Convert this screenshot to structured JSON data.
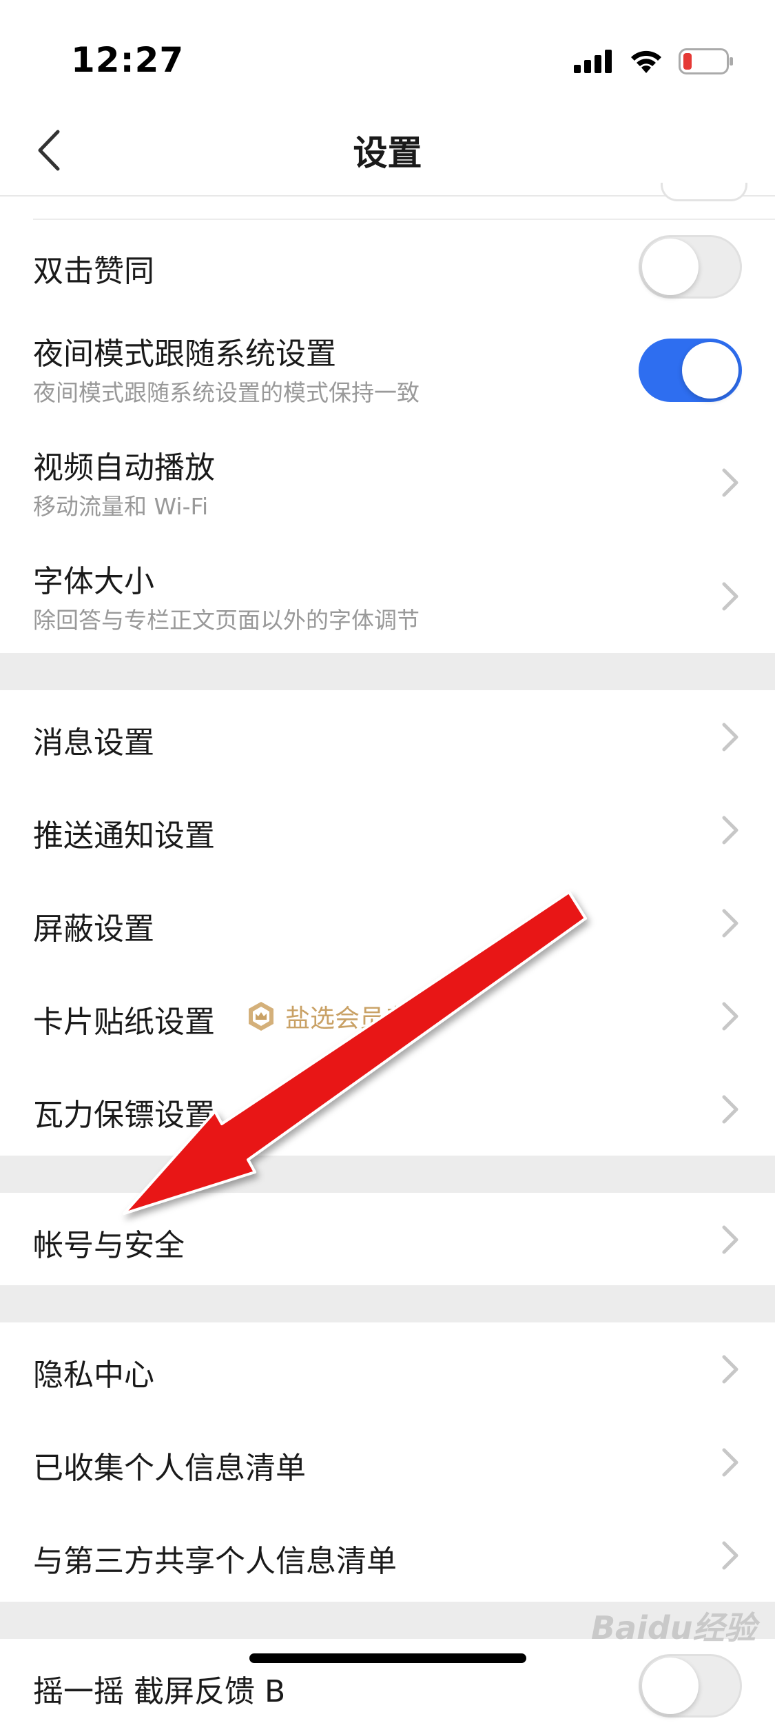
{
  "status_bar": {
    "time": "12:27"
  },
  "nav": {
    "title": "设置"
  },
  "group1": [
    {
      "title": "双击赞同",
      "type": "toggle",
      "on": false
    },
    {
      "title": "夜间模式跟随系统设置",
      "subtitle": "夜间模式跟随系统设置的模式保持一致",
      "type": "toggle",
      "on": true
    },
    {
      "title": "视频自动播放",
      "subtitle": "移动流量和 Wi-Fi",
      "type": "link"
    },
    {
      "title": "字体大小",
      "subtitle": "除回答与专栏正文页面以外的字体调节",
      "type": "link"
    }
  ],
  "group2": [
    {
      "title": "消息设置"
    },
    {
      "title": "推送通知设置"
    },
    {
      "title": "屏蔽设置"
    },
    {
      "title": "卡片贴纸设置",
      "badge": "盐选会员专"
    },
    {
      "title": "瓦力保镖设置"
    }
  ],
  "group3": [
    {
      "title": "帐号与安全"
    }
  ],
  "group4": [
    {
      "title": "隐私中心"
    },
    {
      "title": "已收集个人信息清单"
    },
    {
      "title": "与第三方共享个人信息清单"
    }
  ],
  "group5": [
    {
      "title": "摇一摇 截屏反馈 B"
    }
  ],
  "watermark": "Baidu经验",
  "colors": {
    "accent": "#2e6ef0",
    "separator": "#ececec",
    "badge_gold": "#c9a165",
    "arrow_red": "#e81717"
  }
}
